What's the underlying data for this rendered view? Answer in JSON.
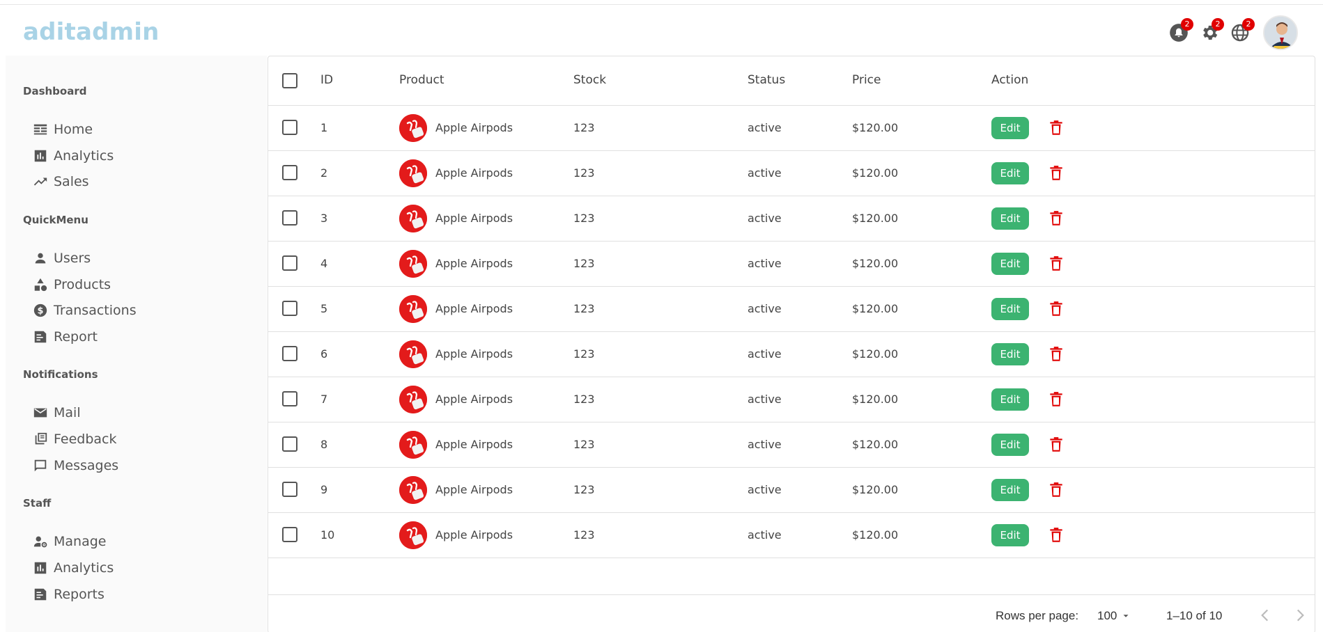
{
  "brand": {
    "logo": "aditadmin",
    "accent": "#a9d3e6"
  },
  "header": {
    "icons": [
      {
        "name": "notifications-icon",
        "badge": "2"
      },
      {
        "name": "gear-icon",
        "badge": "2"
      },
      {
        "name": "globe-icon",
        "badge": "2"
      }
    ],
    "avatar": "user-avatar"
  },
  "sidebar": {
    "sections": [
      {
        "title": "Dashboard",
        "items": [
          {
            "label": "Home",
            "icon": "home-dashboard-icon"
          },
          {
            "label": "Analytics",
            "icon": "analytics-icon"
          },
          {
            "label": "Sales",
            "icon": "trending-up-icon"
          }
        ]
      },
      {
        "title": "QuickMenu",
        "items": [
          {
            "label": "Users",
            "icon": "person-icon"
          },
          {
            "label": "Products",
            "icon": "category-icon"
          },
          {
            "label": "Transactions",
            "icon": "dollar-icon"
          },
          {
            "label": "Report",
            "icon": "report-icon"
          }
        ]
      },
      {
        "title": "Notifications",
        "items": [
          {
            "label": "Mail",
            "icon": "mail-icon"
          },
          {
            "label": "Feedback",
            "icon": "feedback-icon"
          },
          {
            "label": "Messages",
            "icon": "chat-icon"
          }
        ]
      },
      {
        "title": "Staff",
        "items": [
          {
            "label": "Manage",
            "icon": "manage-accounts-icon"
          },
          {
            "label": "Analytics",
            "icon": "analytics-icon"
          },
          {
            "label": "Reports",
            "icon": "report-icon"
          }
        ]
      }
    ]
  },
  "table": {
    "columns": [
      "ID",
      "Product",
      "Stock",
      "Status",
      "Price",
      "Action"
    ],
    "edit_label": "Edit",
    "rows": [
      {
        "id": "1",
        "product": "Apple Airpods",
        "stock": "123",
        "status": "active",
        "price": "$120.00"
      },
      {
        "id": "2",
        "product": "Apple Airpods",
        "stock": "123",
        "status": "active",
        "price": "$120.00"
      },
      {
        "id": "3",
        "product": "Apple Airpods",
        "stock": "123",
        "status": "active",
        "price": "$120.00"
      },
      {
        "id": "4",
        "product": "Apple Airpods",
        "stock": "123",
        "status": "active",
        "price": "$120.00"
      },
      {
        "id": "5",
        "product": "Apple Airpods",
        "stock": "123",
        "status": "active",
        "price": "$120.00"
      },
      {
        "id": "6",
        "product": "Apple Airpods",
        "stock": "123",
        "status": "active",
        "price": "$120.00"
      },
      {
        "id": "7",
        "product": "Apple Airpods",
        "stock": "123",
        "status": "active",
        "price": "$120.00"
      },
      {
        "id": "8",
        "product": "Apple Airpods",
        "stock": "123",
        "status": "active",
        "price": "$120.00"
      },
      {
        "id": "9",
        "product": "Apple Airpods",
        "stock": "123",
        "status": "active",
        "price": "$120.00"
      },
      {
        "id": "10",
        "product": "Apple Airpods",
        "stock": "123",
        "status": "active",
        "price": "$120.00"
      }
    ]
  },
  "pagination": {
    "rows_per_page_label": "Rows per page:",
    "rows_per_page_value": "100",
    "range_text": "1–10 of 10"
  },
  "colors": {
    "edit_button": "#3cb371",
    "delete_icon": "#e00000",
    "badge": "#e00000"
  }
}
